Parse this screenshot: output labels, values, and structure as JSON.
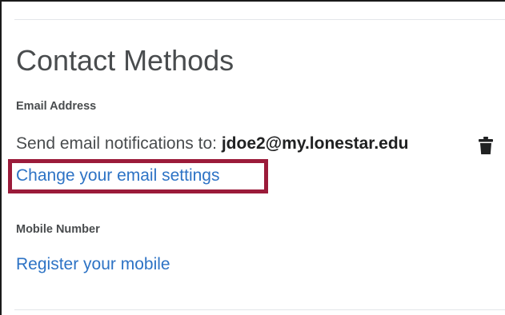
{
  "contact_methods": {
    "title": "Contact Methods",
    "email": {
      "label": "Email Address",
      "notify_prefix": "Send email notifications to:",
      "address": "jdoe2@my.lonestar.edu",
      "delete_icon": "trash-icon",
      "change_link": "Change your email settings"
    },
    "mobile": {
      "label": "Mobile Number",
      "register_link": "Register your mobile"
    }
  },
  "colors": {
    "link": "#2d73c5",
    "text": "#494c4e",
    "highlight": "#9b1b3a"
  }
}
